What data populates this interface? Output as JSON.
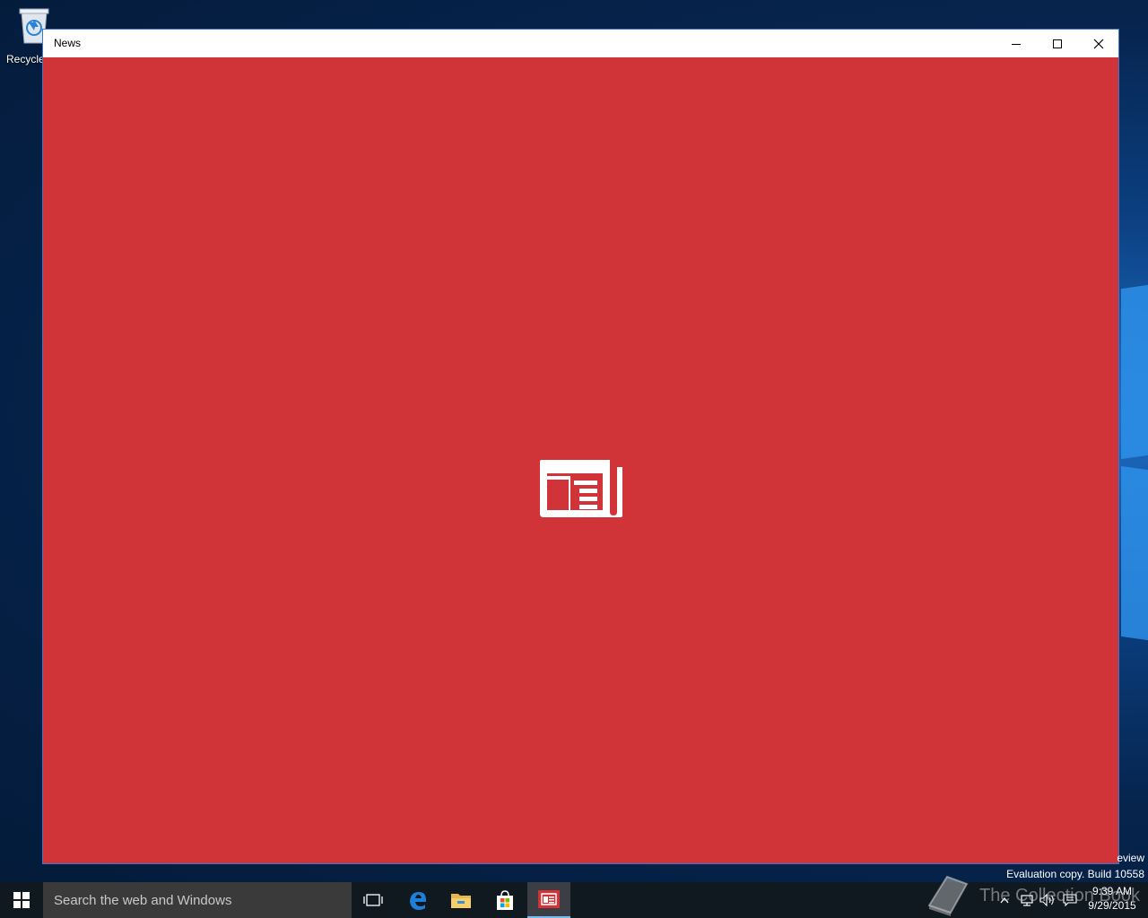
{
  "desktop": {
    "recycle_bin_label": "Recycle"
  },
  "window": {
    "title": "News",
    "controls": {
      "minimize": "minimize",
      "maximize": "maximize",
      "close": "close"
    },
    "splash_color": "#d13438",
    "splash_icon": "newspaper-icon"
  },
  "watermark": {
    "preview_text": "eview",
    "evaluation_text": "Evaluation copy. Build 10558",
    "brand_text": "The Collection Book"
  },
  "taskbar": {
    "search_placeholder": "Search the web and Windows",
    "pinned": [
      {
        "name": "task-view",
        "icon": "task-view-icon"
      },
      {
        "name": "edge",
        "icon": "edge-icon"
      },
      {
        "name": "file-explorer",
        "icon": "folder-icon"
      },
      {
        "name": "store",
        "icon": "store-icon"
      },
      {
        "name": "news",
        "icon": "newspaper-icon",
        "active": true
      }
    ],
    "clock": {
      "time": "9:39 AM",
      "date": "9/29/2015"
    }
  }
}
